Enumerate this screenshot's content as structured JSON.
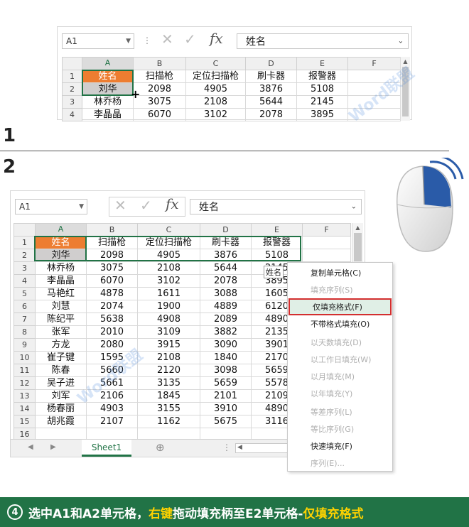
{
  "panel1": {
    "name_box": "A1",
    "formula": "姓名",
    "cols": [
      "A",
      "B",
      "C",
      "D",
      "E",
      "F"
    ],
    "rows": [
      {
        "n": "1",
        "cells": [
          "姓名",
          "扫描枪",
          "定位扫描枪",
          "刷卡器",
          "报警器",
          ""
        ]
      },
      {
        "n": "2",
        "cells": [
          "刘华",
          "2098",
          "4905",
          "3876",
          "5108",
          ""
        ]
      },
      {
        "n": "3",
        "cells": [
          "林乔杨",
          "3075",
          "2108",
          "5644",
          "2145",
          ""
        ]
      },
      {
        "n": "4",
        "cells": [
          "李晶晶",
          "6070",
          "3102",
          "2078",
          "3895",
          ""
        ]
      }
    ]
  },
  "step1": "1",
  "step2": "2",
  "panel2": {
    "name_box": "A1",
    "formula": "姓名",
    "cols": [
      "A",
      "B",
      "C",
      "D",
      "E",
      "F"
    ],
    "rows": [
      {
        "n": "1",
        "cells": [
          "姓名",
          "扫描枪",
          "定位扫描枪",
          "刷卡器",
          "报警器",
          ""
        ]
      },
      {
        "n": "2",
        "cells": [
          "刘华",
          "2098",
          "4905",
          "3876",
          "5108",
          ""
        ]
      },
      {
        "n": "3",
        "cells": [
          "林乔杨",
          "3075",
          "2108",
          "5644",
          "2145",
          ""
        ]
      },
      {
        "n": "4",
        "cells": [
          "李晶晶",
          "6070",
          "3102",
          "2078",
          "3895",
          ""
        ]
      },
      {
        "n": "5",
        "cells": [
          "马艳红",
          "4878",
          "1611",
          "3088",
          "1605",
          ""
        ]
      },
      {
        "n": "6",
        "cells": [
          "刘慧",
          "2074",
          "1900",
          "4889",
          "6120",
          ""
        ]
      },
      {
        "n": "7",
        "cells": [
          "陈纪平",
          "5638",
          "4908",
          "2089",
          "4890",
          ""
        ]
      },
      {
        "n": "8",
        "cells": [
          "张军",
          "2010",
          "3109",
          "3882",
          "2135",
          ""
        ]
      },
      {
        "n": "9",
        "cells": [
          "方龙",
          "2080",
          "3915",
          "3090",
          "3901",
          ""
        ]
      },
      {
        "n": "10",
        "cells": [
          "崔子键",
          "1595",
          "2108",
          "1840",
          "2170",
          ""
        ]
      },
      {
        "n": "11",
        "cells": [
          "陈春",
          "5660",
          "2120",
          "3098",
          "5659",
          ""
        ]
      },
      {
        "n": "12",
        "cells": [
          "吴子进",
          "5661",
          "3135",
          "5659",
          "5578",
          ""
        ]
      },
      {
        "n": "13",
        "cells": [
          "刘军",
          "2106",
          "1845",
          "2101",
          "2109",
          ""
        ]
      },
      {
        "n": "14",
        "cells": [
          "杨春丽",
          "4903",
          "3155",
          "3910",
          "4890",
          ""
        ]
      },
      {
        "n": "15",
        "cells": [
          "胡兆霞",
          "2107",
          "1162",
          "5675",
          "3116",
          ""
        ]
      },
      {
        "n": "16",
        "cells": [
          "",
          "",
          "",
          "",
          "",
          ""
        ]
      }
    ],
    "drag_tooltip": "姓名",
    "sheet_tab": "Sheet1",
    "context_menu": [
      {
        "label": "复制单元格(C)",
        "disabled": false
      },
      {
        "label": "填充序列(S)",
        "disabled": true
      },
      {
        "label": "仅填充格式(F)",
        "disabled": false,
        "highlight": true
      },
      {
        "label": "不带格式填充(O)",
        "disabled": false
      },
      {
        "label": "以天数填充(D)",
        "disabled": true
      },
      {
        "label": "以工作日填充(W)",
        "disabled": true
      },
      {
        "label": "以月填充(M)",
        "disabled": true
      },
      {
        "label": "以年填充(Y)",
        "disabled": true
      },
      {
        "label": "等差序列(L)",
        "disabled": true
      },
      {
        "label": "等比序列(G)",
        "disabled": true
      },
      {
        "label": "快速填充(F)",
        "disabled": false
      },
      {
        "label": "序列(E)...",
        "disabled": true
      }
    ]
  },
  "footer": {
    "num": "4",
    "part1": "选中A1和A2单元格，",
    "part2": "右键",
    "part3": "拖动填充柄至E2单元格-",
    "part4": "仅填充格式"
  },
  "colors": {
    "accent": "#217346",
    "orange": "#ed7d31",
    "highlight_border": "#d32f2f",
    "mouse_blue": "#2a5ba8",
    "footer_yellow": "#ffd200"
  }
}
